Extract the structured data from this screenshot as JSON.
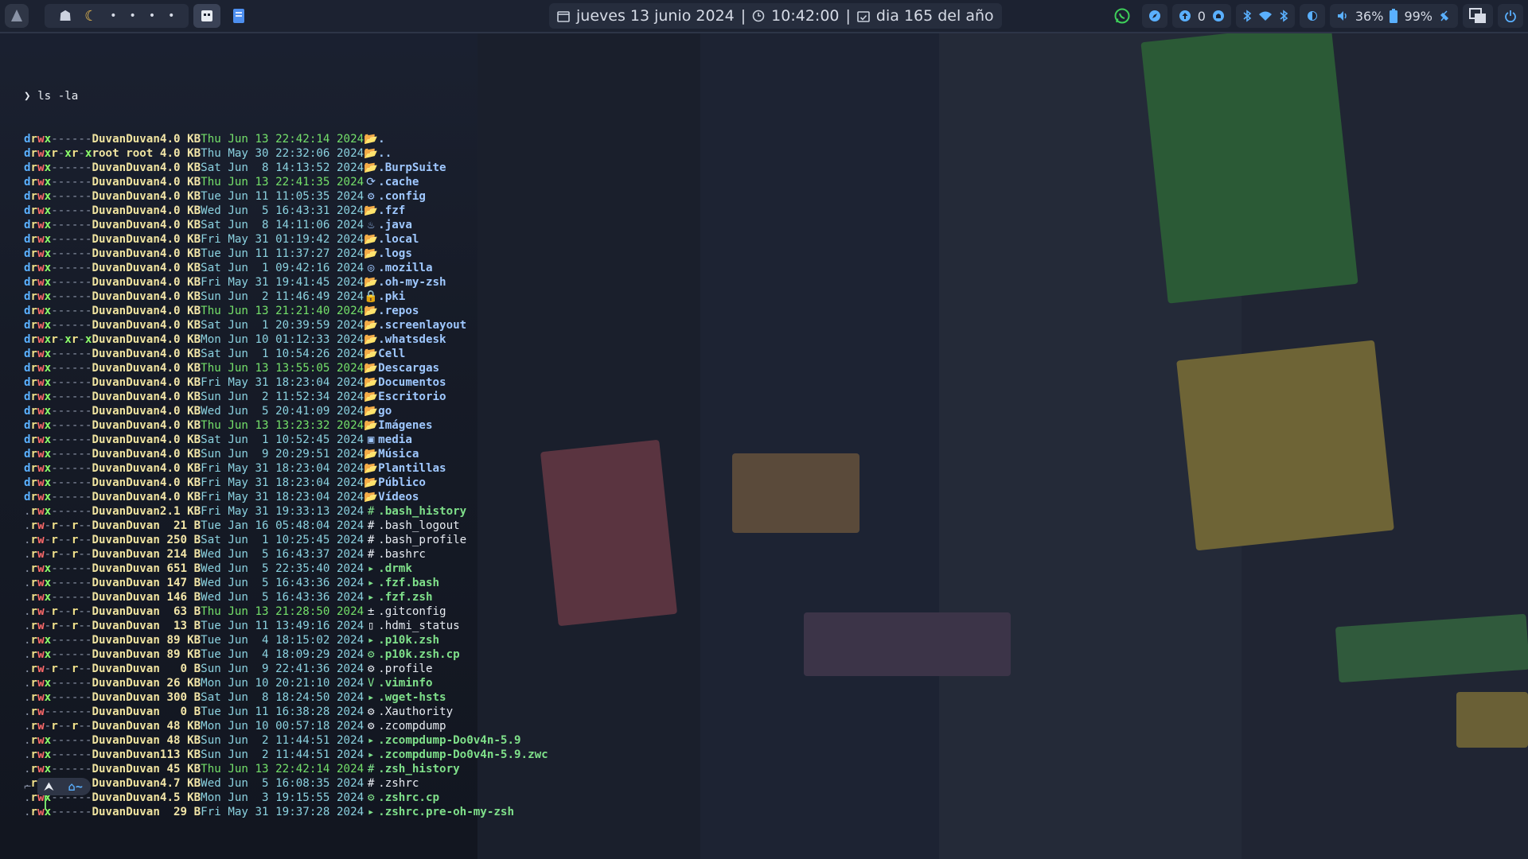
{
  "topbar": {
    "workspaces": [
      "•",
      "•",
      "•",
      "•"
    ],
    "clock": {
      "date": "jueves 13 junio 2024",
      "sep1": "|",
      "time": "10:42:00",
      "sep2": "|",
      "dayofyear": "dia 165 del año"
    },
    "tray": {
      "updates_count": "0",
      "volume": "36%",
      "battery": "99%"
    }
  },
  "terminal": {
    "prompt_symbol": "❯",
    "command": "ls -la",
    "entries": [
      {
        "perm": "drwx------",
        "owner": "Duvan",
        "group": "Duvan",
        "size": "4.0 KB",
        "date": "Thu Jun 13 22:42:14 2024",
        "recent": true,
        "icon": "📂",
        "name": ".",
        "type": "dir"
      },
      {
        "perm": "drwxr-xr-x",
        "owner": "root",
        "group": "root",
        "size": "4.0 KB",
        "date": "Thu May 30 22:32:06 2024",
        "recent": false,
        "icon": "📂",
        "name": "..",
        "type": "dir"
      },
      {
        "perm": "drwx------",
        "owner": "Duvan",
        "group": "Duvan",
        "size": "4.0 KB",
        "date": "Sat Jun  8 14:13:52 2024",
        "recent": false,
        "icon": "📂",
        "name": ".BurpSuite",
        "type": "dir"
      },
      {
        "perm": "drwx------",
        "owner": "Duvan",
        "group": "Duvan",
        "size": "4.0 KB",
        "date": "Thu Jun 13 22:41:35 2024",
        "recent": true,
        "icon": "⟳",
        "name": ".cache",
        "type": "dir"
      },
      {
        "perm": "drwx------",
        "owner": "Duvan",
        "group": "Duvan",
        "size": "4.0 KB",
        "date": "Tue Jun 11 11:05:35 2024",
        "recent": false,
        "icon": "⚙",
        "name": ".config",
        "type": "dir"
      },
      {
        "perm": "drwx------",
        "owner": "Duvan",
        "group": "Duvan",
        "size": "4.0 KB",
        "date": "Wed Jun  5 16:43:31 2024",
        "recent": false,
        "icon": "📂",
        "name": ".fzf",
        "type": "dir"
      },
      {
        "perm": "drwx------",
        "owner": "Duvan",
        "group": "Duvan",
        "size": "4.0 KB",
        "date": "Sat Jun  8 14:11:06 2024",
        "recent": false,
        "icon": "♨",
        "name": ".java",
        "type": "dir"
      },
      {
        "perm": "drwx------",
        "owner": "Duvan",
        "group": "Duvan",
        "size": "4.0 KB",
        "date": "Fri May 31 01:19:42 2024",
        "recent": false,
        "icon": "📂",
        "name": ".local",
        "type": "dir"
      },
      {
        "perm": "drwx------",
        "owner": "Duvan",
        "group": "Duvan",
        "size": "4.0 KB",
        "date": "Tue Jun 11 11:37:27 2024",
        "recent": false,
        "icon": "📂",
        "name": ".logs",
        "type": "dir"
      },
      {
        "perm": "drwx------",
        "owner": "Duvan",
        "group": "Duvan",
        "size": "4.0 KB",
        "date": "Sat Jun  1 09:42:16 2024",
        "recent": false,
        "icon": "◎",
        "name": ".mozilla",
        "type": "dir"
      },
      {
        "perm": "drwx------",
        "owner": "Duvan",
        "group": "Duvan",
        "size": "4.0 KB",
        "date": "Fri May 31 19:41:45 2024",
        "recent": false,
        "icon": "📂",
        "name": ".oh-my-zsh",
        "type": "dir"
      },
      {
        "perm": "drwx------",
        "owner": "Duvan",
        "group": "Duvan",
        "size": "4.0 KB",
        "date": "Sun Jun  2 11:46:49 2024",
        "recent": false,
        "icon": "🔒",
        "name": ".pki",
        "type": "dir"
      },
      {
        "perm": "drwx------",
        "owner": "Duvan",
        "group": "Duvan",
        "size": "4.0 KB",
        "date": "Thu Jun 13 21:21:40 2024",
        "recent": true,
        "icon": "📂",
        "name": ".repos",
        "type": "dir"
      },
      {
        "perm": "drwx------",
        "owner": "Duvan",
        "group": "Duvan",
        "size": "4.0 KB",
        "date": "Sat Jun  1 20:39:59 2024",
        "recent": false,
        "icon": "📂",
        "name": ".screenlayout",
        "type": "dir"
      },
      {
        "perm": "drwxr-xr-x",
        "owner": "Duvan",
        "group": "Duvan",
        "size": "4.0 KB",
        "date": "Mon Jun 10 01:12:33 2024",
        "recent": false,
        "icon": "📂",
        "name": ".whatsdesk",
        "type": "dir"
      },
      {
        "perm": "drwx------",
        "owner": "Duvan",
        "group": "Duvan",
        "size": "4.0 KB",
        "date": "Sat Jun  1 10:54:26 2024",
        "recent": false,
        "icon": "📂",
        "name": "Cell",
        "type": "dir"
      },
      {
        "perm": "drwx------",
        "owner": "Duvan",
        "group": "Duvan",
        "size": "4.0 KB",
        "date": "Thu Jun 13 13:55:05 2024",
        "recent": true,
        "icon": "📂",
        "name": "Descargas",
        "type": "dir"
      },
      {
        "perm": "drwx------",
        "owner": "Duvan",
        "group": "Duvan",
        "size": "4.0 KB",
        "date": "Fri May 31 18:23:04 2024",
        "recent": false,
        "icon": "📂",
        "name": "Documentos",
        "type": "dir"
      },
      {
        "perm": "drwx------",
        "owner": "Duvan",
        "group": "Duvan",
        "size": "4.0 KB",
        "date": "Sun Jun  2 11:52:34 2024",
        "recent": false,
        "icon": "📂",
        "name": "Escritorio",
        "type": "dir"
      },
      {
        "perm": "drwx------",
        "owner": "Duvan",
        "group": "Duvan",
        "size": "4.0 KB",
        "date": "Wed Jun  5 20:41:09 2024",
        "recent": false,
        "icon": "📂",
        "name": "go",
        "type": "dir"
      },
      {
        "perm": "drwx------",
        "owner": "Duvan",
        "group": "Duvan",
        "size": "4.0 KB",
        "date": "Thu Jun 13 13:23:32 2024",
        "recent": true,
        "icon": "📂",
        "name": "Imágenes",
        "type": "dir"
      },
      {
        "perm": "drwx------",
        "owner": "Duvan",
        "group": "Duvan",
        "size": "4.0 KB",
        "date": "Sat Jun  1 10:52:45 2024",
        "recent": false,
        "icon": "▣",
        "name": "media",
        "type": "dir"
      },
      {
        "perm": "drwx------",
        "owner": "Duvan",
        "group": "Duvan",
        "size": "4.0 KB",
        "date": "Sun Jun  9 20:29:51 2024",
        "recent": false,
        "icon": "📂",
        "name": "Música",
        "type": "dir"
      },
      {
        "perm": "drwx------",
        "owner": "Duvan",
        "group": "Duvan",
        "size": "4.0 KB",
        "date": "Fri May 31 18:23:04 2024",
        "recent": false,
        "icon": "📂",
        "name": "Plantillas",
        "type": "dir"
      },
      {
        "perm": "drwx------",
        "owner": "Duvan",
        "group": "Duvan",
        "size": "4.0 KB",
        "date": "Fri May 31 18:23:04 2024",
        "recent": false,
        "icon": "📂",
        "name": "Público",
        "type": "dir"
      },
      {
        "perm": "drwx------",
        "owner": "Duvan",
        "group": "Duvan",
        "size": "4.0 KB",
        "date": "Fri May 31 18:23:04 2024",
        "recent": false,
        "icon": "📂",
        "name": "Vídeos",
        "type": "dir"
      },
      {
        "perm": ".rwx------",
        "owner": "Duvan",
        "group": "Duvan",
        "size": "2.1 KB",
        "date": "Fri May 31 19:33:13 2024",
        "recent": false,
        "icon": "#",
        "name": ".bash_history",
        "type": "exe"
      },
      {
        "perm": ".rw-r--r--",
        "owner": "Duvan",
        "group": "Duvan",
        "size": " 21 B",
        "date": "Tue Jan 16 05:48:04 2024",
        "recent": false,
        "icon": "#",
        "name": ".bash_logout",
        "type": "plain"
      },
      {
        "perm": ".rw-r--r--",
        "owner": "Duvan",
        "group": "Duvan",
        "size": "250 B",
        "date": "Sat Jun  1 10:25:45 2024",
        "recent": false,
        "icon": "#",
        "name": ".bash_profile",
        "type": "plain"
      },
      {
        "perm": ".rw-r--r--",
        "owner": "Duvan",
        "group": "Duvan",
        "size": "214 B",
        "date": "Wed Jun  5 16:43:37 2024",
        "recent": false,
        "icon": "#",
        "name": ".bashrc",
        "type": "plain"
      },
      {
        "perm": ".rwx------",
        "owner": "Duvan",
        "group": "Duvan",
        "size": "651 B",
        "date": "Wed Jun  5 22:35:40 2024",
        "recent": false,
        "icon": "▸",
        "name": ".drmk",
        "type": "exe"
      },
      {
        "perm": ".rwx------",
        "owner": "Duvan",
        "group": "Duvan",
        "size": "147 B",
        "date": "Wed Jun  5 16:43:36 2024",
        "recent": false,
        "icon": "▸",
        "name": ".fzf.bash",
        "type": "exe"
      },
      {
        "perm": ".rwx------",
        "owner": "Duvan",
        "group": "Duvan",
        "size": "146 B",
        "date": "Wed Jun  5 16:43:36 2024",
        "recent": false,
        "icon": "▸",
        "name": ".fzf.zsh",
        "type": "exe"
      },
      {
        "perm": ".rw-r--r--",
        "owner": "Duvan",
        "group": "Duvan",
        "size": " 63 B",
        "date": "Thu Jun 13 21:28:50 2024",
        "recent": true,
        "icon": "±",
        "name": ".gitconfig",
        "type": "plain"
      },
      {
        "perm": ".rw-r--r--",
        "owner": "Duvan",
        "group": "Duvan",
        "size": " 13 B",
        "date": "Tue Jun 11 13:49:16 2024",
        "recent": false,
        "icon": "▯",
        "name": ".hdmi_status",
        "type": "plain"
      },
      {
        "perm": ".rwx------",
        "owner": "Duvan",
        "group": "Duvan",
        "size": " 89 KB",
        "date": "Tue Jun  4 18:15:02 2024",
        "recent": false,
        "icon": "▸",
        "name": ".p10k.zsh",
        "type": "exe"
      },
      {
        "perm": ".rwx------",
        "owner": "Duvan",
        "group": "Duvan",
        "size": " 89 KB",
        "date": "Tue Jun  4 18:09:29 2024",
        "recent": false,
        "icon": "⚙",
        "name": ".p10k.zsh.cp",
        "type": "exe"
      },
      {
        "perm": ".rw-r--r--",
        "owner": "Duvan",
        "group": "Duvan",
        "size": "  0 B",
        "date": "Sun Jun  9 22:41:36 2024",
        "recent": false,
        "icon": "⚙",
        "name": ".profile",
        "type": "plain"
      },
      {
        "perm": ".rwx------",
        "owner": "Duvan",
        "group": "Duvan",
        "size": " 26 KB",
        "date": "Mon Jun 10 20:21:10 2024",
        "recent": false,
        "icon": "V",
        "name": ".viminfo",
        "type": "exe"
      },
      {
        "perm": ".rwx------",
        "owner": "Duvan",
        "group": "Duvan",
        "size": "300 B",
        "date": "Sat Jun  8 18:24:50 2024",
        "recent": false,
        "icon": "▸",
        "name": ".wget-hsts",
        "type": "exe"
      },
      {
        "perm": ".rw-------",
        "owner": "Duvan",
        "group": "Duvan",
        "size": "  0 B",
        "date": "Tue Jun 11 16:38:28 2024",
        "recent": false,
        "icon": "⚙",
        "name": ".Xauthority",
        "type": "plain"
      },
      {
        "perm": ".rw-r--r--",
        "owner": "Duvan",
        "group": "Duvan",
        "size": " 48 KB",
        "date": "Mon Jun 10 00:57:18 2024",
        "recent": false,
        "icon": "⚙",
        "name": ".zcompdump",
        "type": "plain"
      },
      {
        "perm": ".rwx------",
        "owner": "Duvan",
        "group": "Duvan",
        "size": " 48 KB",
        "date": "Sun Jun  2 11:44:51 2024",
        "recent": false,
        "icon": "▸",
        "name": ".zcompdump-Do0v4n-5.9",
        "type": "exe"
      },
      {
        "perm": ".rwx------",
        "owner": "Duvan",
        "group": "Duvan",
        "size": "113 KB",
        "date": "Sun Jun  2 11:44:51 2024",
        "recent": false,
        "icon": "▸",
        "name": ".zcompdump-Do0v4n-5.9.zwc",
        "type": "exe"
      },
      {
        "perm": ".rwx------",
        "owner": "Duvan",
        "group": "Duvan",
        "size": " 45 KB",
        "date": "Thu Jun 13 22:42:14 2024",
        "recent": true,
        "icon": "#",
        "name": ".zsh_history",
        "type": "exe"
      },
      {
        "perm": ".rw-r--r--",
        "owner": "Duvan",
        "group": "Duvan",
        "size": "4.7 KB",
        "date": "Wed Jun  5 16:08:35 2024",
        "recent": false,
        "icon": "#",
        "name": ".zshrc",
        "type": "plain"
      },
      {
        "perm": ".rwx------",
        "owner": "Duvan",
        "group": "Duvan",
        "size": "4.5 KB",
        "date": "Mon Jun  3 19:15:55 2024",
        "recent": false,
        "icon": "⚙",
        "name": ".zshrc.cp",
        "type": "exe"
      },
      {
        "perm": ".rwx------",
        "owner": "Duvan",
        "group": "Duvan",
        "size": " 29 B",
        "date": "Fri May 31 19:37:28 2024",
        "recent": false,
        "icon": "▸",
        "name": ".zshrc.pre-oh-my-zsh",
        "type": "exe"
      }
    ],
    "prompt": {
      "left": "⮝",
      "path": "~"
    }
  },
  "colors": {
    "dir": "#9fc8ff",
    "exe": "#7fe08a",
    "recent_date": "#74e06a",
    "old_date": "#8bd2e0"
  }
}
